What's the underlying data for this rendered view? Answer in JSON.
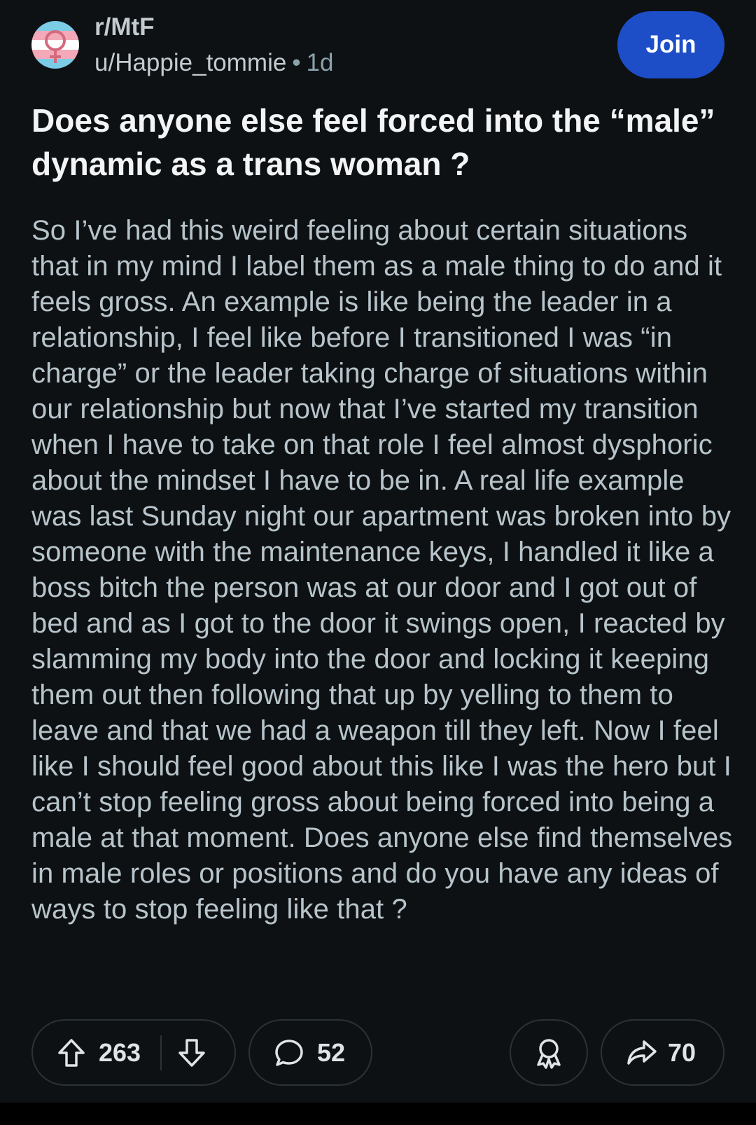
{
  "post": {
    "subreddit": "r/MtF",
    "author": "u/Happie_tommie",
    "separator": "•",
    "age": "1d",
    "join_label": "Join",
    "title": "Does anyone else feel forced into the “male” dynamic as a trans woman ?",
    "body": "So I’ve had this weird feeling about certain situations that in my mind I label them as a male thing to do and it feels gross. An example is like being the leader in a relationship, I feel like before I transitioned I was “in charge” or the leader taking charge of situations within our relationship but now that I’ve started my transition when I have to take on that role I feel almost dysphoric about the mindset I have to be in. A real life example was last Sunday night our apartment was broken into by someone with the maintenance keys, I handled it like a boss bitch the person was at our door and I got out of bed and as I got to the door it swings open, I reacted by slamming my body into the door and locking it keeping them out then following that up by yelling to them to leave and that we had a weapon till they left. Now I feel like I should feel good about this like I was the hero but I can’t stop feeling gross about being forced into being a male at that moment. Does anyone else find themselves in male roles or positions and do you have any ideas of ways to stop feeling like that ?"
  },
  "actions": {
    "upvotes": "263",
    "comments": "52",
    "shares": "70"
  },
  "icons": {
    "avatar": "trans-symbol-avatar",
    "upvote": "upvote-arrow-icon",
    "downvote": "downvote-arrow-icon",
    "comment": "comment-bubble-icon",
    "award": "award-icon",
    "share": "share-arrow-icon"
  },
  "colors": {
    "background": "#0e1113",
    "join_button": "#1d4ec8",
    "body_text": "#b7c4cb",
    "title_text": "#f2f4f5",
    "trans_blue": "#7bcce5",
    "trans_pink": "#f4a9b8"
  }
}
